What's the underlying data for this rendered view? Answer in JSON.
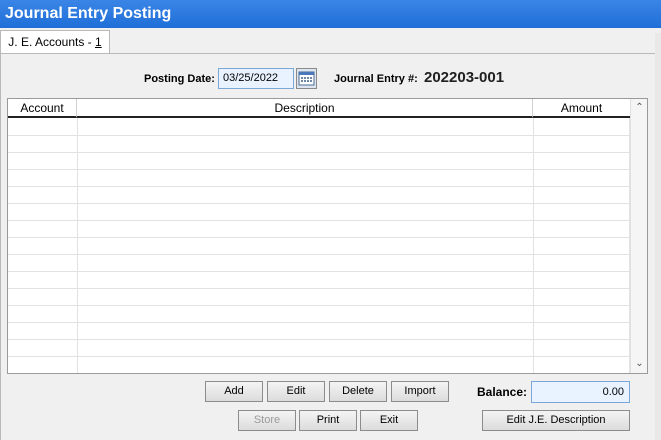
{
  "window": {
    "title": "Journal Entry Posting"
  },
  "tab": {
    "label": "J. E. Accounts - ",
    "number": "1"
  },
  "header": {
    "posting_date_label": "Posting Date:",
    "posting_date_value": "03/25/2022",
    "journal_entry_label": "Journal Entry #:",
    "journal_entry_value": "202203-001"
  },
  "grid": {
    "columns": [
      "Account",
      "Description",
      "Amount"
    ],
    "rows": []
  },
  "buttons": {
    "add": "Add",
    "edit": "Edit",
    "delete": "Delete",
    "import": "Import",
    "store": "Store",
    "print": "Print",
    "exit": "Exit",
    "edit_je_description": "Edit J.E. Description"
  },
  "balance": {
    "label": "Balance:",
    "value": "0.00"
  }
}
